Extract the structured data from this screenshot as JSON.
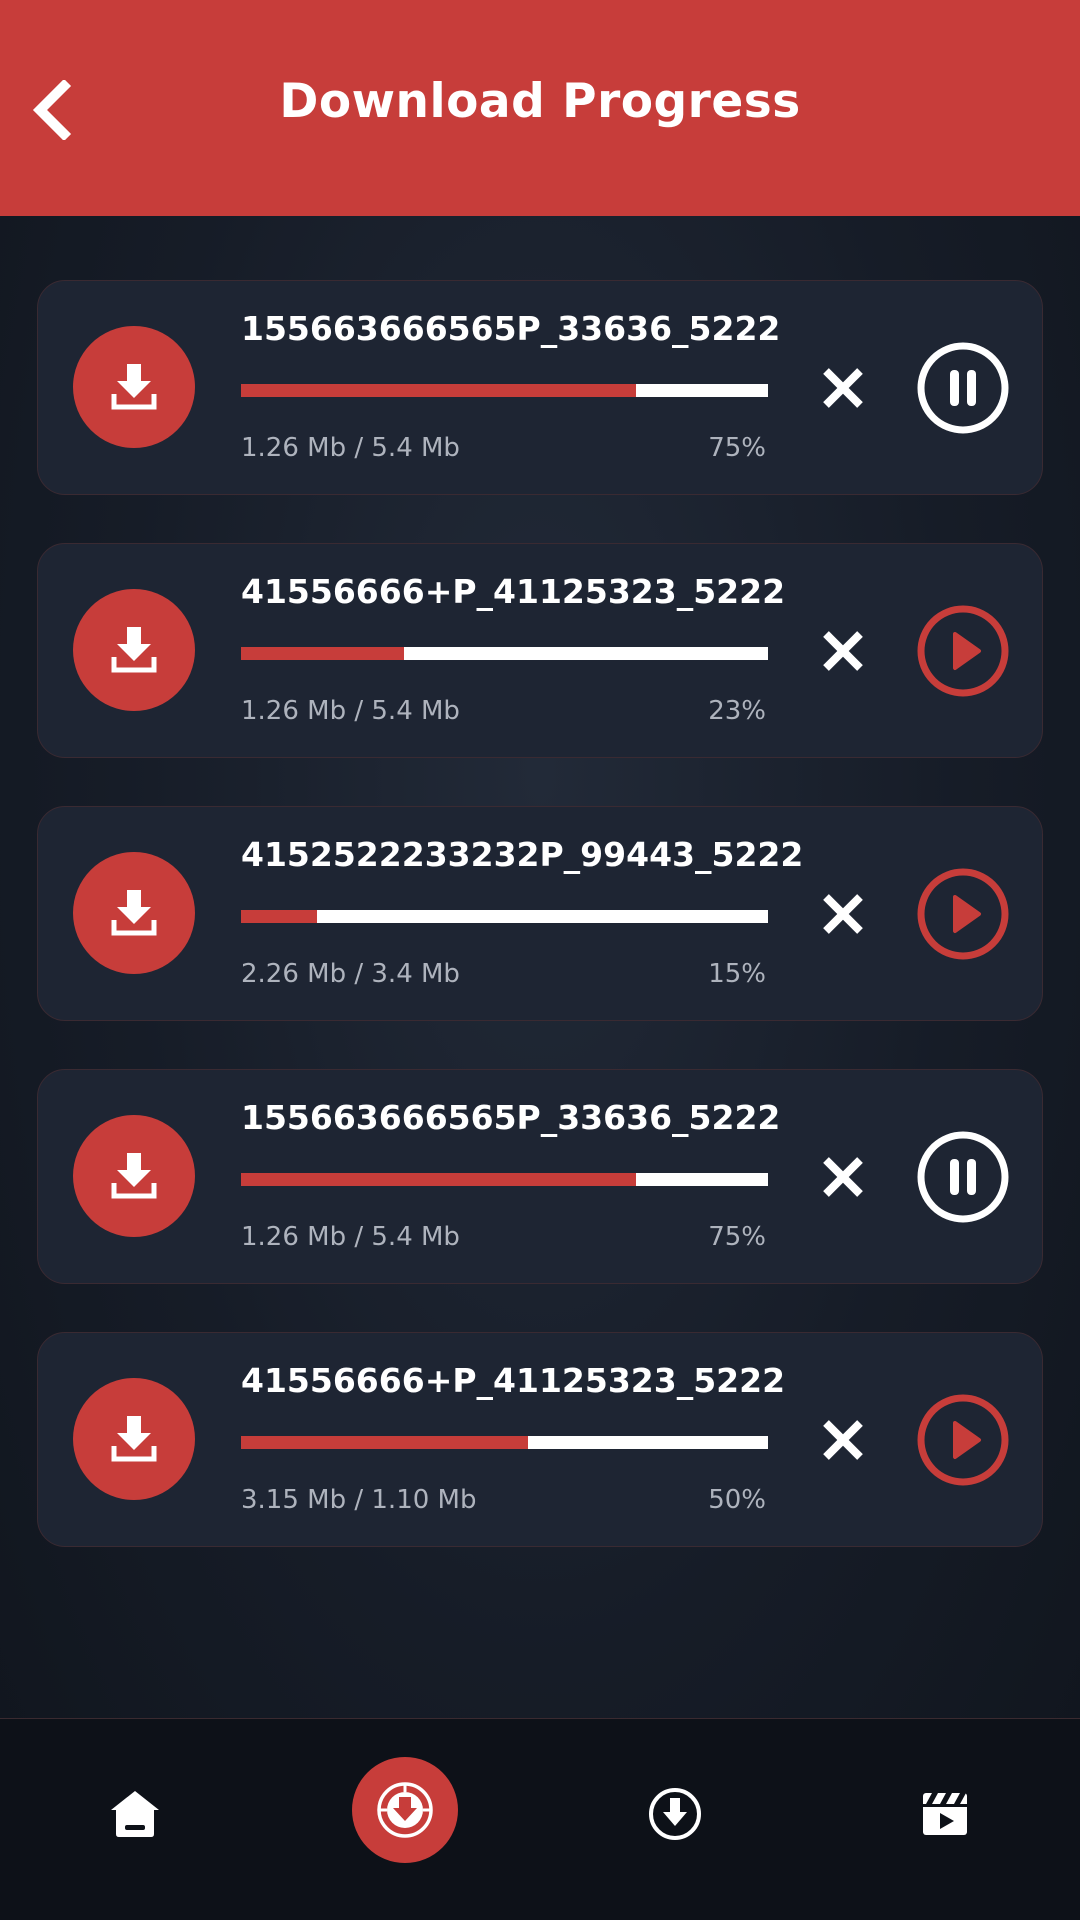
{
  "header": {
    "title": "Download Progress"
  },
  "downloads": [
    {
      "name": "155663666565P_33636_5222",
      "size": "1.26 Mb / 5.4 Mb",
      "percent": "75%",
      "progress": 0.75,
      "state": "downloading",
      "action_icon": "pause-icon"
    },
    {
      "name": "41556666+P_41125323_5222",
      "size": "1.26 Mb / 5.4 Mb",
      "percent": "23%",
      "progress": 0.31,
      "state": "paused",
      "action_icon": "play-icon"
    },
    {
      "name": "4152522233232P_99443_5222",
      "size": "2.26 Mb / 3.4 Mb",
      "percent": "15%",
      "progress": 0.145,
      "state": "paused",
      "action_icon": "play-icon"
    },
    {
      "name": "155663666565P_33636_5222",
      "size": "1.26 Mb / 5.4 Mb",
      "percent": "75%",
      "progress": 0.75,
      "state": "downloading",
      "action_icon": "pause-icon"
    },
    {
      "name": "41556666+P_41125323_5222",
      "size": "3.15 Mb / 1.10 Mb",
      "percent": "50%",
      "progress": 0.545,
      "state": "paused",
      "action_icon": "play-icon"
    }
  ],
  "bottom_nav": {
    "items": [
      {
        "icon": "home-icon",
        "active": false
      },
      {
        "icon": "download-center-icon",
        "active": true
      },
      {
        "icon": "downloads-icon",
        "active": false
      },
      {
        "icon": "video-library-icon",
        "active": false
      }
    ]
  },
  "colors": {
    "accent": "#c73d3a",
    "card_bg": "#1e2533",
    "page_bg": "#161c27",
    "muted_text": "#aeb3bd"
  }
}
